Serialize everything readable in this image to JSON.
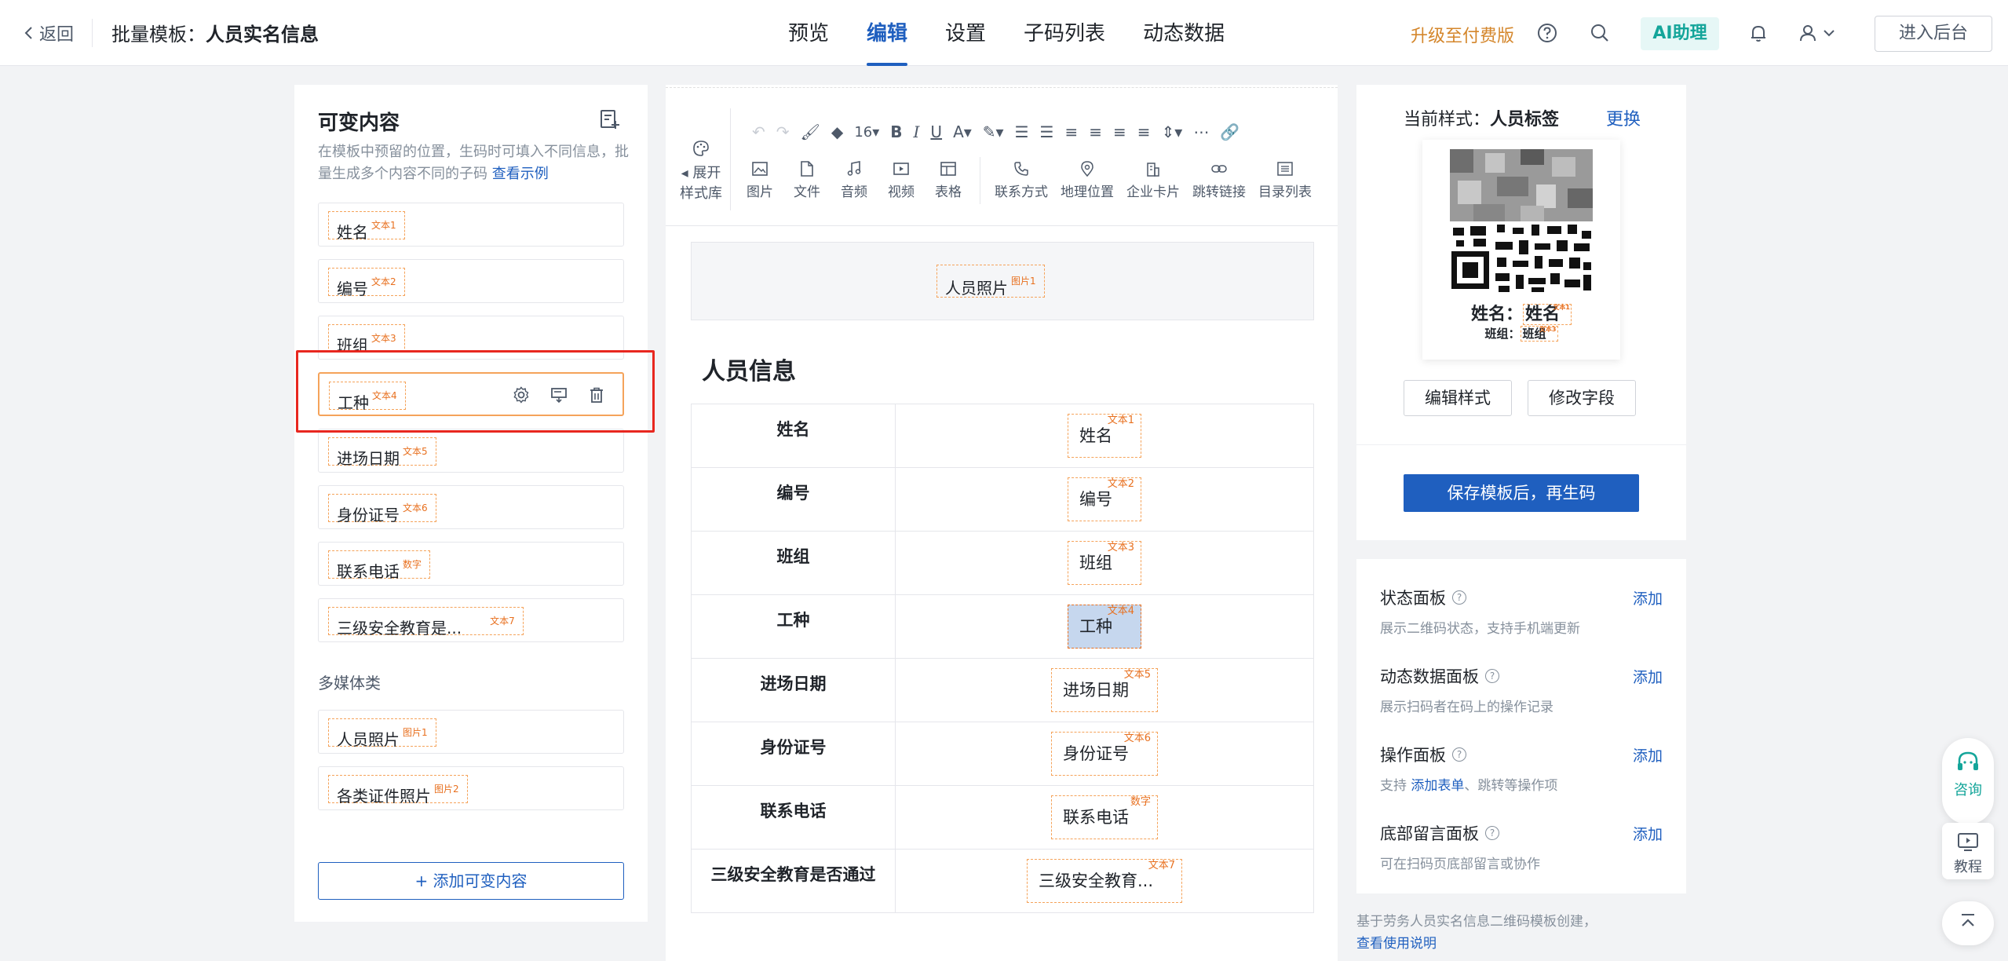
{
  "topbar": {
    "back_label": "返回",
    "title_label": "批量模板：",
    "title_name": "人员实名信息",
    "nav": [
      "预览",
      "编辑",
      "设置",
      "子码列表",
      "动态数据"
    ],
    "active_nav": "编辑",
    "upgrade": "升级至付费版",
    "ai_label": "AI助理",
    "admin_label": "进入后台"
  },
  "left": {
    "title": "可变内容",
    "desc": "在模板中预留的位置，生码时可填入不同信息，批量生成多个内容不同的子码",
    "example_link": "查看示例",
    "text_items": [
      {
        "label": "姓名",
        "tag": "文本1"
      },
      {
        "label": "编号",
        "tag": "文本2"
      },
      {
        "label": "班组",
        "tag": "文本3"
      },
      {
        "label": "工种",
        "tag": "文本4"
      },
      {
        "label": "进场日期",
        "tag": "文本5"
      },
      {
        "label": "身份证号",
        "tag": "文本6"
      },
      {
        "label": "联系电话",
        "tag": "数字"
      },
      {
        "label": "三级安全教育是...",
        "tag": "文本7"
      }
    ],
    "media_label": "多媒体类",
    "media_items": [
      {
        "label": "人员照片",
        "tag": "图片1"
      },
      {
        "label": "各类证件照片",
        "tag": "图片2"
      }
    ],
    "add_button": "+ 添加可变内容"
  },
  "toolbar": {
    "expand_line1": "展开",
    "expand_line2": "样式库",
    "font_size": "16",
    "insert_items": [
      "图片",
      "文件",
      "音频",
      "视频",
      "表格"
    ],
    "insert_items2": [
      "联系方式",
      "地理位置",
      "企业卡片",
      "跳转链接",
      "目录列表"
    ]
  },
  "editor": {
    "photo_tag": {
      "label": "人员照片",
      "tag": "图片1"
    },
    "section_title": "人员信息",
    "rows": [
      {
        "key": "姓名",
        "label": "姓名",
        "tag": "文本1"
      },
      {
        "key": "编号",
        "label": "编号",
        "tag": "文本2"
      },
      {
        "key": "班组",
        "label": "班组",
        "tag": "文本3"
      },
      {
        "key": "工种",
        "label": "工种",
        "tag": "文本4"
      },
      {
        "key": "进场日期",
        "label": "进场日期",
        "tag": "文本5"
      },
      {
        "key": "身份证号",
        "label": "身份证号",
        "tag": "文本6"
      },
      {
        "key": "联系电话",
        "label": "联系电话",
        "tag": "数字"
      },
      {
        "key": "三级安全教育是否通过",
        "label": "三级安全教育...",
        "tag": "文本7"
      }
    ]
  },
  "right": {
    "style_prefix": "当前样式：",
    "style_name": "人员标签",
    "change": "更换",
    "card_line1_key": "姓名：",
    "card_line1_val": "姓名",
    "card_line1_tag": "文本1",
    "card_line2_key": "班组：",
    "card_line2_val": "班组",
    "card_line2_tag": "文本3",
    "edit_style": "编辑样式",
    "edit_fields": "修改字段",
    "save": "保存模板后，再生码",
    "panels": [
      {
        "name": "状态面板",
        "desc": "展示二维码状态，支持手机端更新",
        "add": "添加"
      },
      {
        "name": "动态数据面板",
        "desc": "展示扫码者在码上的操作记录",
        "add": "添加"
      },
      {
        "name": "操作面板",
        "desc_pre": "支持 ",
        "desc_link": "添加表单",
        "desc_post": "、跳转等操作项",
        "add": "添加"
      },
      {
        "name": "底部留言面板",
        "desc": "可在扫码页底部留言或协作",
        "add": "添加"
      }
    ],
    "footnote": "基于劳务人员实名信息二维码模板创建，",
    "footnote_link": "查看使用说明"
  },
  "floating": {
    "consult": "咨询",
    "tutorial": "教程"
  },
  "colors": {
    "accent": "#1f5fbf",
    "tag_border": "#f5a35a",
    "tag_text": "#e8701f",
    "highlight": "#e8271f",
    "ai_green": "#14a59a",
    "upgrade_orange": "#d4862b"
  }
}
